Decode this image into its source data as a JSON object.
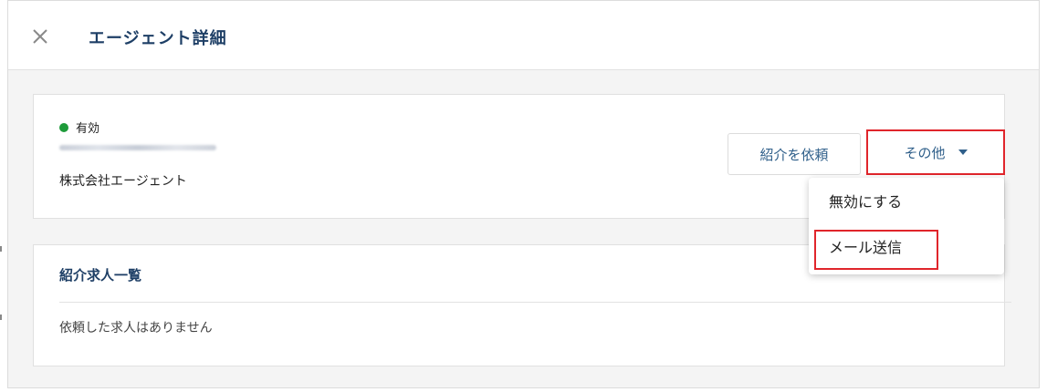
{
  "header": {
    "title": "エージェント詳細",
    "close_icon": "close-icon"
  },
  "agent": {
    "status_label": "有効",
    "status_color": "#1e9b3a",
    "company_name": "株式会社エージェント"
  },
  "actions": {
    "request_label": "紹介を依頼",
    "more_label": "その他",
    "more_icon": "caret-down-icon"
  },
  "dropdown": {
    "items": [
      {
        "label": "無効にする"
      },
      {
        "label": "メール送信"
      }
    ]
  },
  "listing": {
    "title": "紹介求人一覧",
    "empty_message": "依頼した求人はありません"
  },
  "colors": {
    "accent": "#2f5f8a",
    "title": "#1e3f66",
    "highlight": "#e0252b"
  }
}
